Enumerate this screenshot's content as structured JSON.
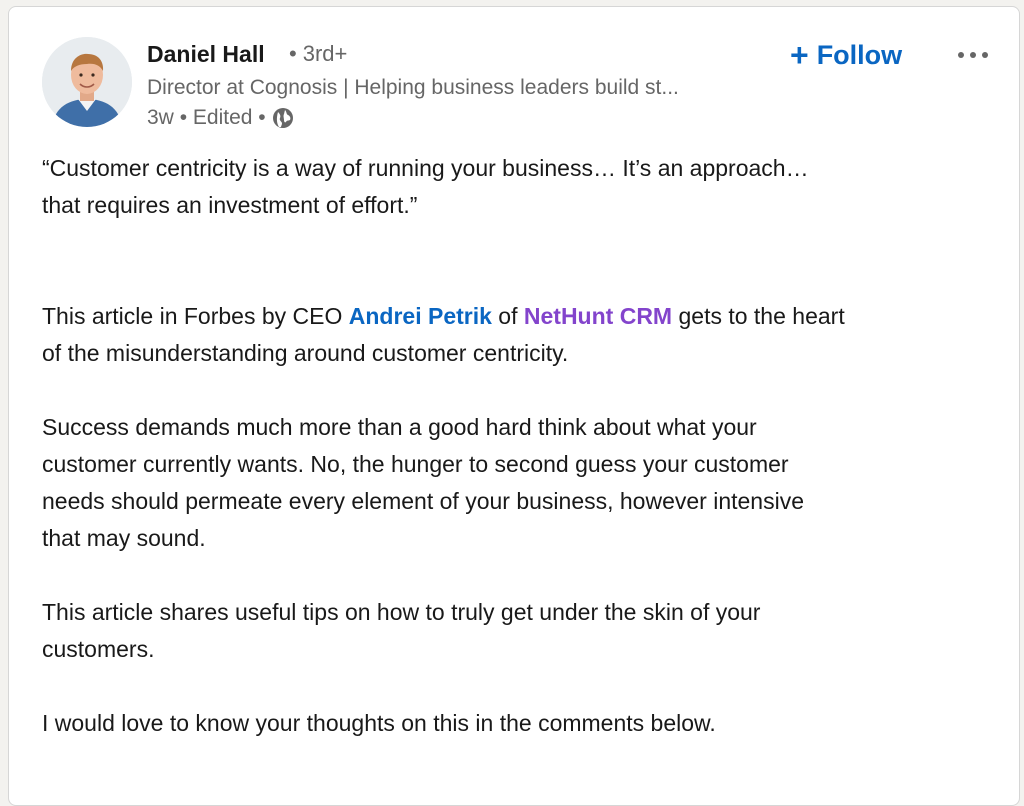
{
  "post": {
    "author": {
      "name": "Daniel Hall",
      "degree": "3rd+",
      "headline": "Director at Cognosis | Helping business leaders build st...",
      "time": "3w",
      "edited": "Edited",
      "visibility_icon": "globe-icon",
      "avatar_icon": "avatar-photo"
    },
    "follow_label": "Follow",
    "follow_icon": "+",
    "more_icon": "more-horizontal-icon",
    "body": {
      "quote_line1": "“Customer centricity is a way of running your business… It’s an approach…",
      "quote_line2": "that requires an investment of effort.”",
      "p2_pre": "This article in Forbes by CEO ",
      "p2_mention_person": "Andrei Petrik",
      "p2_mid": " of ",
      "p2_mention_company": "NetHunt CRM",
      "p2_post": " gets to the heart",
      "p2_line2": "of the misunderstanding around customer centricity.",
      "p3_line1": "Success demands much more than a good hard think about what your",
      "p3_line2": "customer currently wants. No, the hunger to second guess your customer",
      "p3_line3": "needs should permeate every element of your business, however intensive",
      "p3_line4": "that may sound.",
      "p4_line1": "This article shares useful tips on how to truly get under the skin of your",
      "p4_line2": "customers.",
      "p5_line1": "I would love to know your thoughts on this in the comments below."
    },
    "colors": {
      "link_blue": "#0a66c2",
      "company_purple": "#8344cc",
      "secondary_text": "#666666"
    }
  }
}
